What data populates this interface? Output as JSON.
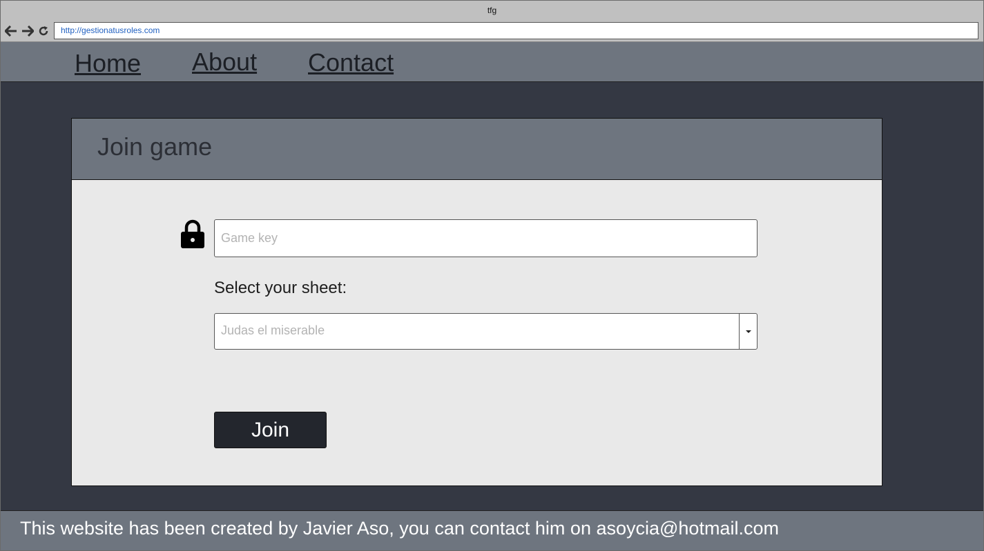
{
  "browser": {
    "window_title": "tfg",
    "url": "http://gestionatusroles.com",
    "back_icon": "arrow-left-icon",
    "forward_icon": "arrow-right-icon",
    "reload_icon": "reload-icon"
  },
  "nav": {
    "items": [
      {
        "label": "Home"
      },
      {
        "label": "About"
      },
      {
        "label": "Contact"
      }
    ]
  },
  "card": {
    "title": "Join game",
    "key_icon": "lock-icon",
    "key_placeholder": "Game key",
    "key_value": "",
    "select_label": "Select your sheet:",
    "select_value": "Judas el miserable",
    "join_label": "Join"
  },
  "footer": {
    "text": "This website has been created by Javier Aso, you can contact him on asoycia@hotmail.com"
  },
  "colors": {
    "page_background": "#343843",
    "bar_background": "#6e757f",
    "card_background": "#e9e9e9",
    "button_background": "#23262d"
  }
}
